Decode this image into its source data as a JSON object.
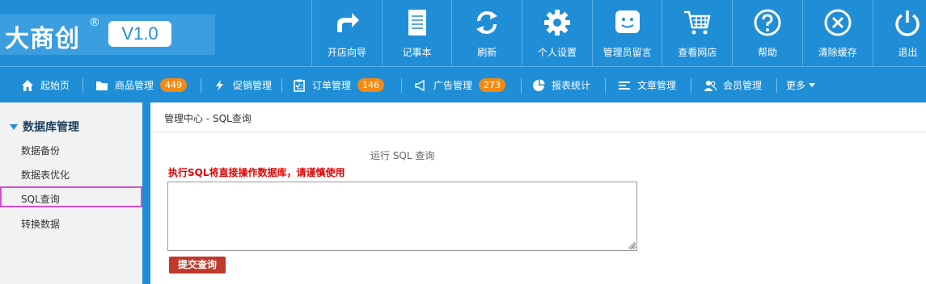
{
  "logo": {
    "text": "大商创",
    "reg": "®",
    "version": "V1.0"
  },
  "topnav": [
    {
      "label": "开店向导",
      "icon": "share-arrow-icon"
    },
    {
      "label": "记事本",
      "icon": "notepad-icon"
    },
    {
      "label": "刷新",
      "icon": "refresh-icon"
    },
    {
      "label": "个人设置",
      "icon": "gear-icon"
    },
    {
      "label": "管理员留言",
      "icon": "message-smile-icon"
    },
    {
      "label": "查看网店",
      "icon": "shopping-cart-icon"
    },
    {
      "label": "帮助",
      "icon": "question-icon"
    },
    {
      "label": "清除缓存",
      "icon": "clear-cache-icon"
    },
    {
      "label": "退出",
      "icon": "power-icon"
    }
  ],
  "subnav": [
    {
      "label": "起始页",
      "icon": "home-icon"
    },
    {
      "label": "商品管理",
      "icon": "folder-icon",
      "badge": "449"
    },
    {
      "label": "促销管理",
      "icon": "lightning-icon"
    },
    {
      "label": "订单管理",
      "icon": "clipboard-icon",
      "badge": "146"
    },
    {
      "label": "广告管理",
      "icon": "megaphone-icon",
      "badge": "273"
    },
    {
      "label": "报表统计",
      "icon": "pie-chart-icon"
    },
    {
      "label": "文章管理",
      "icon": "list-icon"
    },
    {
      "label": "会员管理",
      "icon": "users-icon"
    },
    {
      "label": "更多",
      "icon": "caret-down-icon"
    }
  ],
  "sidebar": {
    "title": "数据库管理",
    "items": [
      "数据备份",
      "数据表优化",
      "SQL查询",
      "转换数据"
    ],
    "active_index": 2
  },
  "main": {
    "breadcrumb": "管理中心 - SQL查询",
    "caption": "运行 SQL 查询",
    "warning": "执行SQL将直接操作数据库，请谨慎使用",
    "sql_value": "",
    "submit_label": "提交查询"
  },
  "colors": {
    "primary": "#1f8ed6",
    "badge": "#f28b16",
    "danger": "#c0392b",
    "warning_text": "#e10000",
    "highlight": "#d54ed0"
  }
}
